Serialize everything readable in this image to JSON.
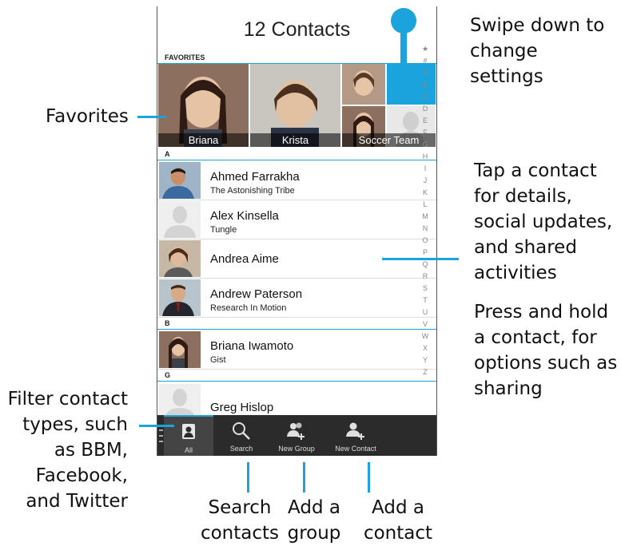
{
  "header": {
    "title": "12 Contacts"
  },
  "favorites": {
    "section_label": "FAVORITES",
    "items": [
      {
        "label": "Briana"
      },
      {
        "label": "Krista"
      },
      {
        "label": "Soccer Team"
      }
    ]
  },
  "sections": {
    "a": "A",
    "b": "B",
    "g": "G"
  },
  "contacts": [
    {
      "name": "Ahmed Farrakha",
      "subtitle": "The Astonishing Tribe"
    },
    {
      "name": "Alex Kinsella",
      "subtitle": "Tungle"
    },
    {
      "name": "Andrea Aime"
    },
    {
      "name": "Andrew Paterson",
      "subtitle": "Research In Motion"
    },
    {
      "name": "Briana Iwamoto",
      "subtitle": "Gist"
    },
    {
      "name": "Greg Hislop"
    }
  ],
  "alphabet": [
    "★",
    "#",
    "A",
    "B",
    "C",
    "D",
    "E",
    "F",
    "G",
    "H",
    "I",
    "J",
    "K",
    "L",
    "M",
    "N",
    "O",
    "P",
    "Q",
    "R",
    "S",
    "T",
    "U",
    "V",
    "W",
    "X",
    "Y",
    "Z"
  ],
  "toolbar": {
    "all_label": "All",
    "search_label": "Search",
    "new_group_label": "New Group",
    "new_contact_label": "New Contact"
  },
  "callouts": {
    "swipe": "Swipe down to change settings",
    "favorites": "Favorites",
    "tap_contact": "Tap a contact for details, social updates, and shared activities",
    "press_hold": "Press and hold a contact, for options such as sharing",
    "filter": "Filter contact types, such as BBM, Facebook, and Twitter",
    "search": "Search contacts",
    "add_group": "Add a group",
    "add_contact": "Add a contact"
  },
  "colors": {
    "accent": "#1aa3dc",
    "toolbar": "#2b2b2b"
  }
}
